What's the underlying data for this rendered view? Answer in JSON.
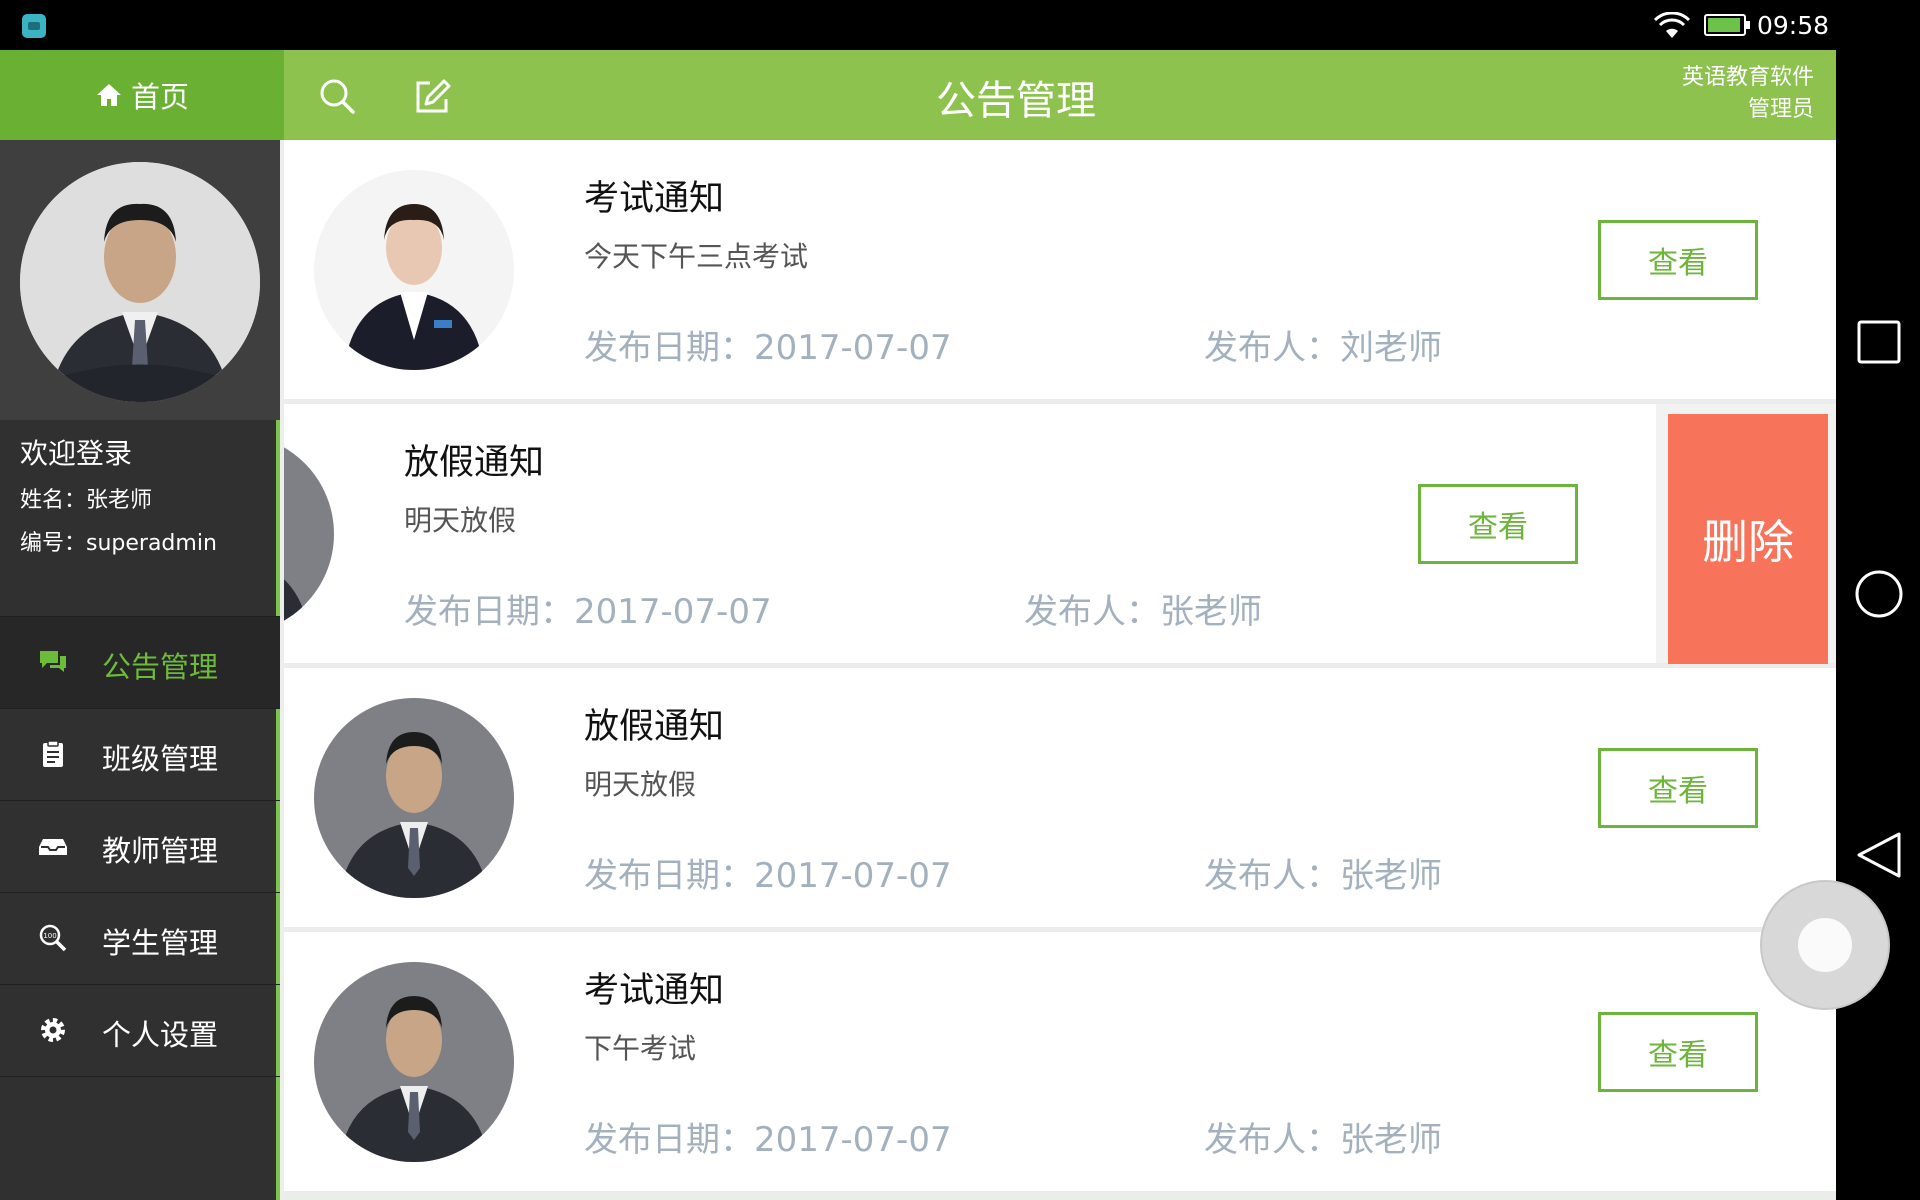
{
  "status_bar": {
    "time": "09:58"
  },
  "sidebar": {
    "home_label": "首页",
    "welcome": "欢迎登录",
    "name_line": "姓名：张老师",
    "id_line": "编号：superadmin",
    "menu": [
      {
        "label": "公告管理",
        "icon": "chat-bubbles-icon",
        "active": true
      },
      {
        "label": "班级管理",
        "icon": "clipboard-icon",
        "active": false
      },
      {
        "label": "教师管理",
        "icon": "inbox-tray-icon",
        "active": false
      },
      {
        "label": "学生管理",
        "icon": "score-search-icon",
        "active": false
      },
      {
        "label": "个人设置",
        "icon": "gear-icon",
        "active": false
      }
    ]
  },
  "header": {
    "title": "公告管理",
    "app_name_line1": "英语教育软件",
    "app_name_line2": "管理员"
  },
  "notices": [
    {
      "title": "考试通知",
      "content": "今天下午三点考试",
      "date": "发布日期：2017-07-07",
      "publisher": "发布人：刘老师",
      "view_label": "查看",
      "avatar": "female-teacher-photo"
    },
    {
      "title": "放假通知",
      "content": "明天放假",
      "date": "发布日期：2017-07-07",
      "publisher": "发布人：张老师",
      "view_label": "查看",
      "delete_label": "删除",
      "avatar": "male-teacher-photo"
    },
    {
      "title": "放假通知",
      "content": "明天放假",
      "date": "发布日期：2017-07-07",
      "publisher": "发布人：张老师",
      "view_label": "查看",
      "avatar": "male-teacher-photo"
    },
    {
      "title": "考试通知",
      "content": "下午考试",
      "date": "发布日期：2017-07-07",
      "publisher": "发布人：张老师",
      "view_label": "查看",
      "avatar": "male-teacher-photo"
    }
  ],
  "colors": {
    "header_green": "#8dc24e",
    "home_green": "#6ab032",
    "sidebar_dark": "#2f302f",
    "accent_green": "#6db43b",
    "delete_red": "#f7735a",
    "meta_gray": "#a3b0be"
  }
}
